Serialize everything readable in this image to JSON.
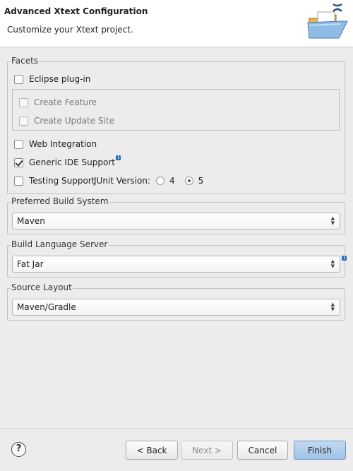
{
  "header": {
    "title": "Advanced Xtext Configuration",
    "subtitle": "Customize your Xtext project."
  },
  "facets": {
    "legend": "Facets",
    "eclipse_plugin": {
      "label": "Eclipse plug-in",
      "checked": false
    },
    "create_feature": {
      "label": "Create Feature",
      "checked": false,
      "enabled": false
    },
    "create_update_site": {
      "label": "Create Update Site",
      "checked": false,
      "enabled": false
    },
    "web_integration": {
      "label": "Web Integration",
      "checked": false
    },
    "generic_ide_support": {
      "label": "Generic IDE Support",
      "checked": true
    },
    "testing_support": {
      "label": "Testing Support",
      "checked": false
    },
    "junit_version": {
      "label": "JUnit Version:",
      "options": [
        "4",
        "5"
      ],
      "selected": "5"
    }
  },
  "build_system": {
    "legend": "Preferred Build System",
    "value": "Maven"
  },
  "language_server": {
    "legend": "Build Language Server",
    "value": "Fat Jar"
  },
  "source_layout": {
    "legend": "Source Layout",
    "value": "Maven/Gradle"
  },
  "footer": {
    "help_glyph": "?",
    "back_label": "< Back",
    "next_label": "Next >",
    "cancel_label": "Cancel",
    "finish_label": "Finish"
  },
  "icons": {
    "info_glyph": "i",
    "combo_arrows": "▲▼"
  }
}
